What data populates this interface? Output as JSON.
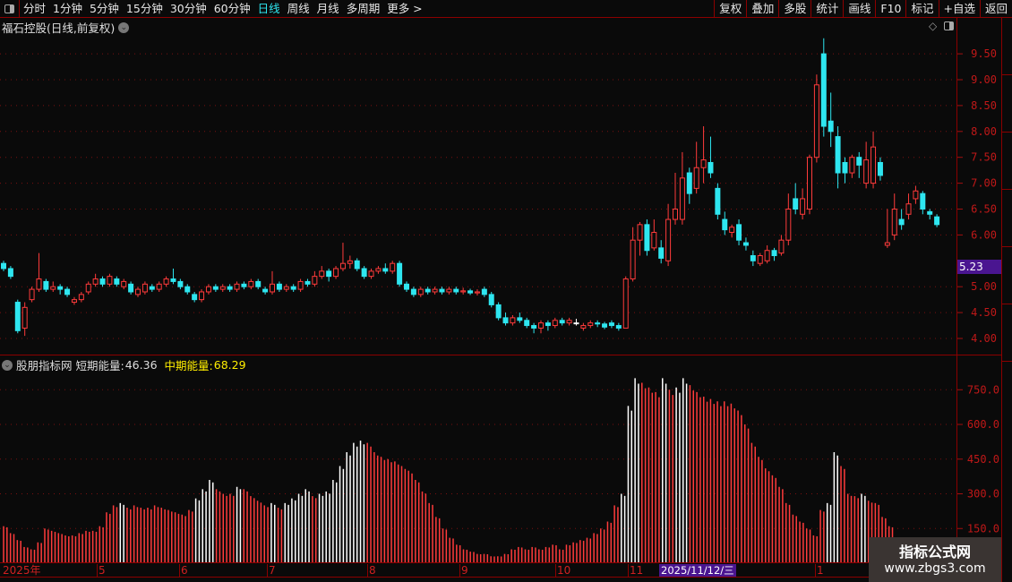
{
  "toolbar": {
    "periods": [
      "分时",
      "1分钟",
      "5分钟",
      "15分钟",
      "30分钟",
      "60分钟",
      "日线",
      "周线",
      "月线",
      "多周期",
      "更多 >"
    ],
    "active_period": "日线",
    "right_buttons": [
      "复权",
      "叠加",
      "多股",
      "统计",
      "画线",
      "F10",
      "标记",
      "+自选",
      "返回"
    ]
  },
  "stock_title": "福石控股(日线,前复权)",
  "price_axis": {
    "labels": [
      "9.50",
      "9.00",
      "8.50",
      "8.00",
      "7.50",
      "7.00",
      "6.50",
      "6.00",
      "5.00",
      "4.50",
      "4.00"
    ],
    "last_price": "5.23"
  },
  "indicator": {
    "name": "股朋指标网",
    "short_label": "短期能量:",
    "short_value": "46.36",
    "mid_label": "中期能量:",
    "mid_value": "68.29",
    "axis_labels": [
      "750.0",
      "600.0",
      "450.0",
      "300.0",
      "150.0"
    ],
    "values": [
      160,
      130,
      100,
      70,
      60,
      90,
      150,
      140,
      130,
      120,
      120,
      130,
      140,
      140,
      160,
      220,
      250,
      260,
      240,
      250,
      240,
      240,
      250,
      240,
      230,
      220,
      210,
      230,
      280,
      320,
      360,
      320,
      300,
      300,
      330,
      320,
      290,
      270,
      250,
      260,
      240,
      260,
      280,
      300,
      320,
      290,
      300,
      310,
      360,
      420,
      480,
      520,
      530,
      520,
      480,
      460,
      450,
      440,
      420,
      400,
      360,
      310,
      260,
      200,
      150,
      110,
      80,
      60,
      50,
      40,
      40,
      30,
      30,
      40,
      60,
      70,
      60,
      70,
      60,
      70,
      80,
      60,
      80,
      90,
      100,
      110,
      130,
      150,
      180,
      250,
      300,
      680,
      800,
      780,
      760,
      740,
      800,
      750,
      760,
      800,
      770,
      740,
      720,
      710,
      700,
      700,
      690,
      660,
      600,
      520,
      460,
      410,
      380,
      330,
      260,
      210,
      180,
      150,
      120,
      230,
      260,
      480,
      420,
      300,
      290,
      300,
      270,
      260,
      200,
      160,
      110,
      80,
      60,
      40,
      30,
      90,
      60
    ]
  },
  "colors": {
    "up": "#ff3b3b",
    "down": "#2ee6f0",
    "flat": "#ffffff",
    "axis": "#c01818",
    "mid_energy": "#ffee00",
    "highlight": "#4a1590"
  },
  "candles": [
    [
      5.45,
      5.35,
      5.5,
      5.3
    ],
    [
      5.35,
      5.2,
      5.4,
      5.15
    ],
    [
      4.7,
      4.15,
      4.75,
      4.1
    ],
    [
      4.2,
      4.6,
      4.7,
      4.05
    ],
    [
      4.75,
      4.95,
      5.0,
      4.7
    ],
    [
      4.95,
      5.15,
      5.65,
      4.9
    ],
    [
      5.1,
      4.95,
      5.15,
      4.9
    ],
    [
      4.95,
      5.0,
      5.1,
      4.9
    ],
    [
      5.0,
      4.95,
      5.05,
      4.85
    ],
    [
      4.95,
      4.85,
      5.0,
      4.8
    ],
    [
      4.7,
      4.75,
      4.8,
      4.65
    ],
    [
      4.75,
      4.85,
      4.9,
      4.7
    ],
    [
      4.9,
      5.05,
      5.1,
      4.85
    ],
    [
      5.05,
      5.15,
      5.25,
      5.0
    ],
    [
      5.15,
      5.05,
      5.2,
      5.0
    ],
    [
      5.05,
      5.2,
      5.25,
      5.0
    ],
    [
      5.15,
      5.05,
      5.2,
      5.0
    ],
    [
      5.0,
      5.1,
      5.15,
      4.95
    ],
    [
      5.05,
      4.9,
      5.1,
      4.85
    ],
    [
      4.85,
      4.95,
      5.0,
      4.8
    ],
    [
      4.9,
      5.05,
      5.1,
      4.85
    ],
    [
      5.0,
      4.95,
      5.05,
      4.9
    ],
    [
      4.95,
      5.05,
      5.1,
      4.9
    ],
    [
      5.05,
      5.15,
      5.2,
      5.0
    ],
    [
      5.15,
      5.1,
      5.35,
      5.05
    ],
    [
      5.1,
      5.0,
      5.15,
      4.95
    ],
    [
      5.0,
      4.9,
      5.05,
      4.85
    ],
    [
      4.85,
      4.75,
      4.9,
      4.7
    ],
    [
      4.75,
      4.9,
      4.95,
      4.7
    ],
    [
      4.9,
      5.0,
      5.05,
      4.85
    ],
    [
      5.0,
      4.95,
      5.05,
      4.9
    ],
    [
      4.95,
      5.0,
      5.05,
      4.9
    ],
    [
      5.0,
      4.95,
      5.05,
      4.9
    ],
    [
      4.95,
      5.05,
      5.1,
      4.9
    ],
    [
      5.05,
      5.0,
      5.1,
      4.95
    ],
    [
      5.0,
      5.1,
      5.15,
      4.95
    ],
    [
      5.1,
      5.0,
      5.15,
      4.95
    ],
    [
      4.95,
      4.9,
      5.0,
      4.85
    ],
    [
      4.9,
      5.05,
      5.3,
      4.85
    ],
    [
      5.05,
      4.95,
      5.1,
      4.9
    ],
    [
      4.95,
      5.0,
      5.05,
      4.9
    ],
    [
      5.0,
      4.95,
      5.05,
      4.9
    ],
    [
      4.95,
      5.1,
      5.15,
      4.9
    ],
    [
      5.1,
      5.05,
      5.15,
      5.0
    ],
    [
      5.05,
      5.2,
      5.3,
      5.0
    ],
    [
      5.2,
      5.3,
      5.4,
      5.15
    ],
    [
      5.3,
      5.2,
      5.35,
      5.1
    ],
    [
      5.2,
      5.35,
      5.4,
      5.15
    ],
    [
      5.35,
      5.45,
      5.85,
      5.3
    ],
    [
      5.45,
      5.5,
      5.6,
      5.35
    ],
    [
      5.5,
      5.35,
      5.55,
      5.3
    ],
    [
      5.35,
      5.2,
      5.4,
      5.15
    ],
    [
      5.2,
      5.3,
      5.35,
      5.15
    ],
    [
      5.3,
      5.35,
      5.4,
      5.25
    ],
    [
      5.35,
      5.3,
      5.45,
      5.25
    ],
    [
      5.3,
      5.45,
      5.5,
      5.25
    ],
    [
      5.45,
      5.05,
      5.5,
      5.0
    ],
    [
      5.05,
      4.95,
      5.1,
      4.9
    ],
    [
      4.95,
      4.85,
      5.0,
      4.8
    ],
    [
      4.85,
      4.95,
      5.0,
      4.8
    ],
    [
      4.95,
      4.9,
      5.0,
      4.85
    ],
    [
      4.9,
      4.95,
      5.0,
      4.85
    ],
    [
      4.95,
      4.9,
      5.0,
      4.85
    ],
    [
      4.9,
      4.95,
      5.0,
      4.85
    ],
    [
      4.95,
      4.9,
      5.0,
      4.85
    ],
    [
      4.9,
      4.92,
      4.98,
      4.85
    ],
    [
      4.92,
      4.88,
      4.96,
      4.84
    ],
    [
      4.88,
      4.9,
      4.95,
      4.83
    ],
    [
      4.95,
      4.85,
      5.0,
      4.8
    ],
    [
      4.85,
      4.65,
      4.9,
      4.6
    ],
    [
      4.65,
      4.4,
      4.7,
      4.35
    ],
    [
      4.4,
      4.3,
      4.5,
      4.25
    ],
    [
      4.3,
      4.4,
      4.45,
      4.25
    ],
    [
      4.4,
      4.35,
      4.5,
      4.3
    ],
    [
      4.35,
      4.25,
      4.4,
      4.2
    ],
    [
      4.25,
      4.2,
      4.3,
      4.1
    ],
    [
      4.2,
      4.3,
      4.35,
      4.1
    ],
    [
      4.3,
      4.25,
      4.35,
      4.15
    ],
    [
      4.25,
      4.35,
      4.4,
      4.2
    ],
    [
      4.35,
      4.3,
      4.4,
      4.25
    ],
    [
      4.3,
      4.35,
      4.4,
      4.25
    ],
    [
      4.3,
      4.3,
      4.38,
      4.25
    ],
    [
      4.2,
      4.25,
      4.3,
      4.15
    ],
    [
      4.25,
      4.3,
      4.35,
      4.2
    ],
    [
      4.3,
      4.28,
      4.35,
      4.22
    ],
    [
      4.28,
      4.22,
      4.32,
      4.18
    ],
    [
      4.3,
      4.25,
      4.35,
      4.2
    ],
    [
      4.25,
      4.2,
      4.3,
      4.15
    ],
    [
      4.2,
      5.15,
      5.2,
      4.2
    ],
    [
      5.15,
      5.9,
      6.15,
      5.1
    ],
    [
      5.9,
      6.2,
      6.25,
      5.6
    ],
    [
      6.2,
      5.7,
      6.3,
      5.6
    ],
    [
      5.75,
      6.05,
      6.3,
      5.7
    ],
    [
      5.75,
      5.55,
      5.9,
      5.45
    ],
    [
      5.5,
      6.3,
      6.6,
      5.4
    ],
    [
      6.3,
      6.5,
      7.2,
      6.2
    ],
    [
      6.3,
      7.1,
      7.6,
      6.2
    ],
    [
      7.2,
      6.8,
      7.3,
      6.6
    ],
    [
      6.9,
      7.3,
      7.8,
      6.8
    ],
    [
      7.3,
      7.45,
      8.1,
      7.0
    ],
    [
      7.4,
      7.2,
      7.9,
      7.1
    ],
    [
      6.9,
      6.4,
      7.0,
      6.3
    ],
    [
      6.3,
      6.1,
      6.45,
      6.0
    ],
    [
      6.05,
      6.15,
      6.2,
      5.95
    ],
    [
      6.2,
      5.9,
      6.3,
      5.8
    ],
    [
      5.85,
      5.8,
      5.95,
      5.7
    ],
    [
      5.6,
      5.5,
      5.7,
      5.4
    ],
    [
      5.45,
      5.6,
      5.65,
      5.4
    ],
    [
      5.5,
      5.7,
      5.8,
      5.45
    ],
    [
      5.7,
      5.6,
      5.75,
      5.5
    ],
    [
      5.65,
      5.9,
      6.0,
      5.6
    ],
    [
      5.9,
      6.5,
      6.8,
      5.8
    ],
    [
      6.7,
      6.5,
      7.0,
      6.4
    ],
    [
      6.4,
      6.7,
      6.9,
      6.3
    ],
    [
      6.5,
      7.5,
      7.55,
      6.4
    ],
    [
      7.5,
      8.9,
      9.1,
      7.4
    ],
    [
      9.5,
      8.1,
      9.8,
      7.9
    ],
    [
      8.2,
      8.0,
      8.75,
      7.7
    ],
    [
      7.9,
      7.2,
      8.1,
      6.9
    ],
    [
      7.4,
      7.2,
      7.5,
      7.0
    ],
    [
      7.2,
      7.5,
      7.55,
      7.1
    ],
    [
      7.5,
      7.35,
      7.6,
      7.1
    ],
    [
      7.0,
      7.45,
      7.8,
      6.9
    ],
    [
      7.0,
      7.7,
      8.0,
      6.9
    ],
    [
      7.4,
      7.15,
      7.5,
      7.05
    ],
    [
      5.8,
      5.85,
      6.5,
      5.75
    ],
    [
      6.0,
      6.5,
      6.8,
      5.9
    ],
    [
      6.3,
      6.2,
      6.5,
      6.1
    ],
    [
      6.4,
      6.6,
      6.8,
      6.3
    ],
    [
      6.7,
      6.85,
      6.95,
      6.6
    ],
    [
      6.8,
      6.5,
      6.85,
      6.4
    ],
    [
      6.45,
      6.4,
      6.5,
      6.3
    ],
    [
      6.35,
      6.2,
      6.4,
      6.15
    ]
  ],
  "time_axis": {
    "labels": [
      "2025年",
      "5",
      "6",
      "7",
      "8",
      "9",
      "10",
      "11",
      "1"
    ],
    "cursor_date": "2025/11/12/三"
  },
  "watermark": {
    "line1": "指标公式网",
    "line2": "www.zbgs3.com"
  }
}
